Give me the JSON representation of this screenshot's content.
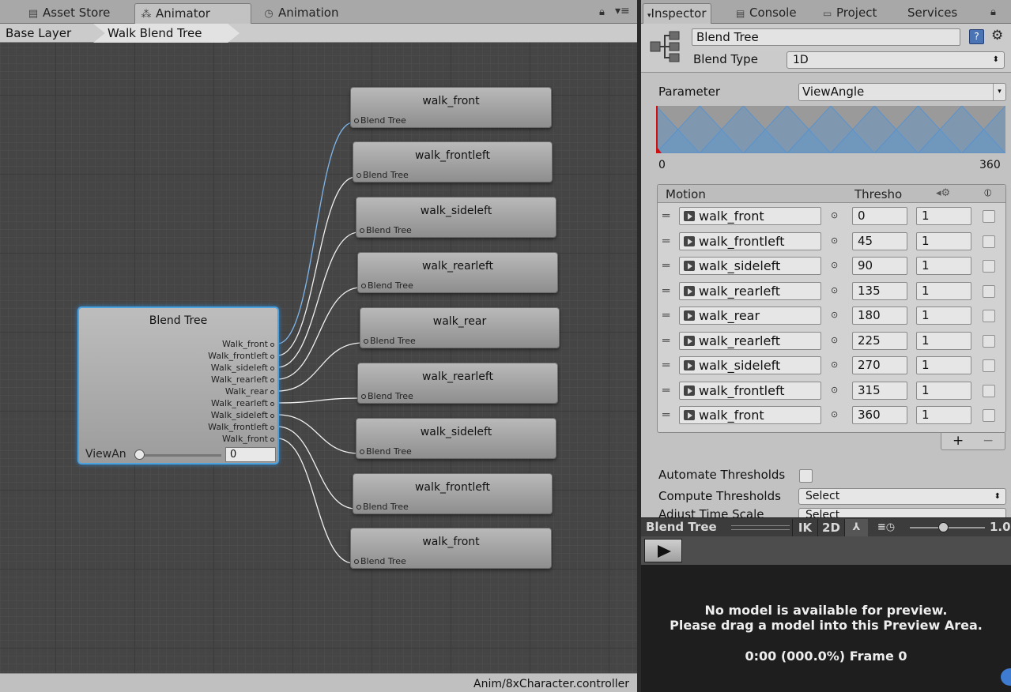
{
  "left_tabs": [
    {
      "label": "Asset Store",
      "icon": "store-icon"
    },
    {
      "label": "Animator",
      "icon": "animator-icon"
    },
    {
      "label": "Animation",
      "icon": "clock-icon"
    }
  ],
  "breadcrumb": [
    "Base Layer",
    "Walk Blend Tree"
  ],
  "blend_tree_node": {
    "title": "Blend Tree",
    "outputs": [
      "Walk_front",
      "Walk_frontleft",
      "Walk_sideleft",
      "Walk_rearleft",
      "Walk_rear",
      "Walk_rearleft",
      "Walk_sideleft",
      "Walk_frontleft",
      "Walk_front"
    ],
    "param_label": "ViewAn",
    "param_value": "0"
  },
  "child_nodes": [
    {
      "title": "walk_front",
      "port": "Blend Tree"
    },
    {
      "title": "walk_frontleft",
      "port": "Blend Tree"
    },
    {
      "title": "walk_sideleft",
      "port": "Blend Tree"
    },
    {
      "title": "walk_rearleft",
      "port": "Blend Tree"
    },
    {
      "title": "walk_rear",
      "port": "Blend Tree"
    },
    {
      "title": "walk_rearleft",
      "port": "Blend Tree"
    },
    {
      "title": "walk_sideleft",
      "port": "Blend Tree"
    },
    {
      "title": "walk_frontleft",
      "port": "Blend Tree"
    },
    {
      "title": "walk_front",
      "port": "Blend Tree"
    }
  ],
  "status_path": "Anim/8xCharacter.controller",
  "right_tabs": [
    {
      "label": "Inspector",
      "icon": "dropdown-icon"
    },
    {
      "label": "Console",
      "icon": "console-icon"
    },
    {
      "label": "Project",
      "icon": "folder-icon"
    },
    {
      "label": "Services",
      "icon": ""
    }
  ],
  "inspector": {
    "name": "Blend Tree",
    "blend_type_label": "Blend Type",
    "blend_type_value": "1D",
    "parameter_label": "Parameter",
    "parameter_value": "ViewAngle",
    "range_min": "0",
    "range_max": "360",
    "motion_header": "Motion",
    "threshold_header": "Thresho",
    "motions": [
      {
        "name": "walk_front",
        "threshold": "0",
        "speed": "1"
      },
      {
        "name": "walk_frontleft",
        "threshold": "45",
        "speed": "1"
      },
      {
        "name": "walk_sideleft",
        "threshold": "90",
        "speed": "1"
      },
      {
        "name": "walk_rearleft",
        "threshold": "135",
        "speed": "1"
      },
      {
        "name": "walk_rear",
        "threshold": "180",
        "speed": "1"
      },
      {
        "name": "walk_rearleft",
        "threshold": "225",
        "speed": "1"
      },
      {
        "name": "walk_sideleft",
        "threshold": "270",
        "speed": "1"
      },
      {
        "name": "walk_frontleft",
        "threshold": "315",
        "speed": "1"
      },
      {
        "name": "walk_front",
        "threshold": "360",
        "speed": "1"
      }
    ],
    "add_label": "+",
    "remove_label": "−",
    "automate_label": "Automate Thresholds",
    "compute_label": "Compute Thresholds",
    "compute_value": "Select",
    "adjust_label": "Adjust Time Scale",
    "adjust_value": "Select"
  },
  "preview": {
    "title": "Blend Tree",
    "ik_label": "IK",
    "mode_label": "2D",
    "speed": "1.0",
    "message_line1": "No model is available for preview.",
    "message_line2": "Please drag a model into this Preview Area.",
    "frame_info": "0:00 (000.0%) Frame 0"
  },
  "colors": {
    "selection": "#4aa3e0",
    "graph_bg": "#454545",
    "panel_bg": "#c2c2c2"
  }
}
